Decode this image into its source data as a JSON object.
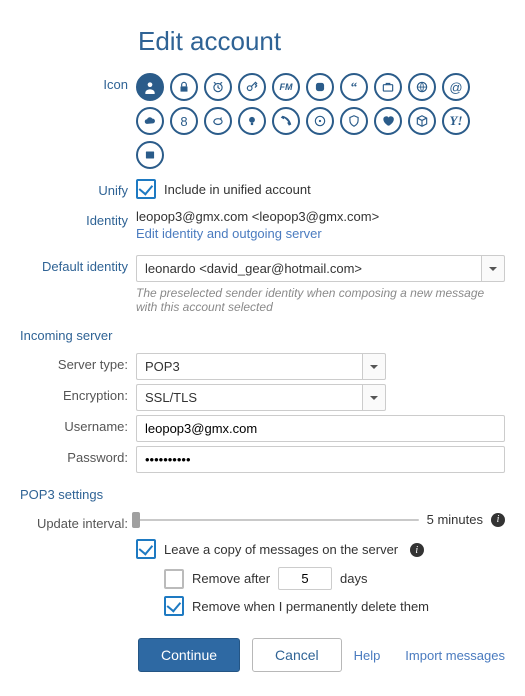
{
  "title": "Edit account",
  "labels": {
    "icon": "Icon",
    "unify": "Unify",
    "identity": "Identity",
    "default_identity": "Default identity",
    "incoming_server": "Incoming server",
    "server_type": "Server type:",
    "encryption": "Encryption:",
    "username": "Username:",
    "password": "Password:",
    "pop3_settings": "POP3 settings",
    "update_interval": "Update interval:"
  },
  "unify": {
    "include_label": "Include in unified account"
  },
  "identity": {
    "text": "leopop3@gmx.com <leopop3@gmx.com>",
    "edit_link": "Edit identity and outgoing server"
  },
  "default_identity": {
    "value": "leonardo <david_gear@hotmail.com>",
    "hint": "The preselected sender identity when composing a new message with this account selected"
  },
  "server": {
    "type": "POP3",
    "encryption": "SSL/TLS",
    "username": "leopop3@gmx.com",
    "password_mask": "••••••••••"
  },
  "pop3": {
    "interval_label": "5 minutes",
    "leave_copy": "Leave a copy of messages on the server",
    "remove_after_pre": "Remove after",
    "remove_after_days": "5",
    "remove_after_post": "days",
    "remove_on_delete": "Remove when I permanently delete them"
  },
  "buttons": {
    "continue": "Continue",
    "cancel": "Cancel",
    "help": "Help",
    "import": "Import messages"
  }
}
